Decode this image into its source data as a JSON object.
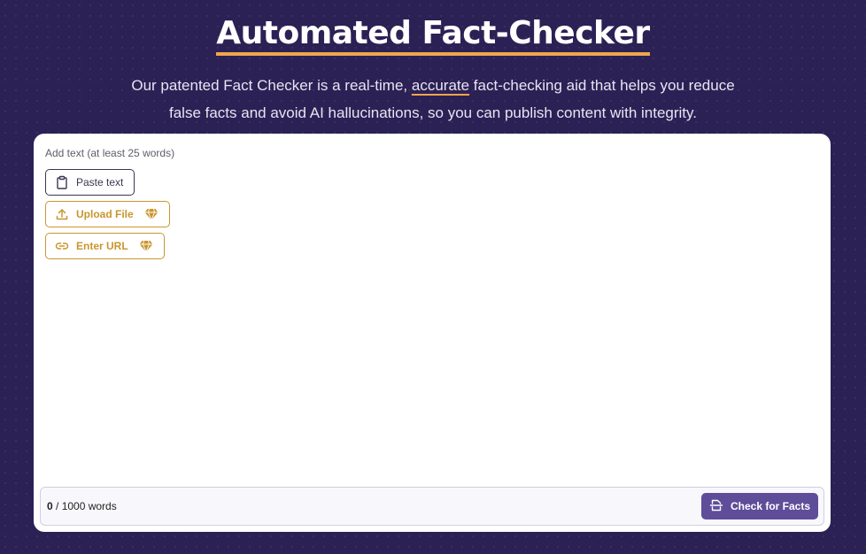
{
  "hero": {
    "title": "Automated Fact-Checker",
    "subtitle_part1": "Our patented Fact Checker is a real-time, ",
    "subtitle_highlight": "accurate",
    "subtitle_part2": " fact-checking aid that helps you reduce false facts and avoid AI hallucinations, so you can publish content with integrity."
  },
  "editor": {
    "hint": "Add text (at least 25 words)",
    "buttons": {
      "paste": "Paste text",
      "upload": "Upload File",
      "url": "Enter URL"
    },
    "word_count": "0",
    "word_limit_text": " / 1000 words",
    "check_button": "Check for Facts"
  },
  "icons": {
    "paste": "clipboard-icon",
    "upload": "upload-icon",
    "url": "link-icon",
    "premium": "diamond-icon",
    "check": "document-scan-icon"
  },
  "colors": {
    "background": "#2b2155",
    "accent_orange": "#f2a54a",
    "premium_gold": "#c9962e",
    "primary_button": "#5f4d99"
  }
}
